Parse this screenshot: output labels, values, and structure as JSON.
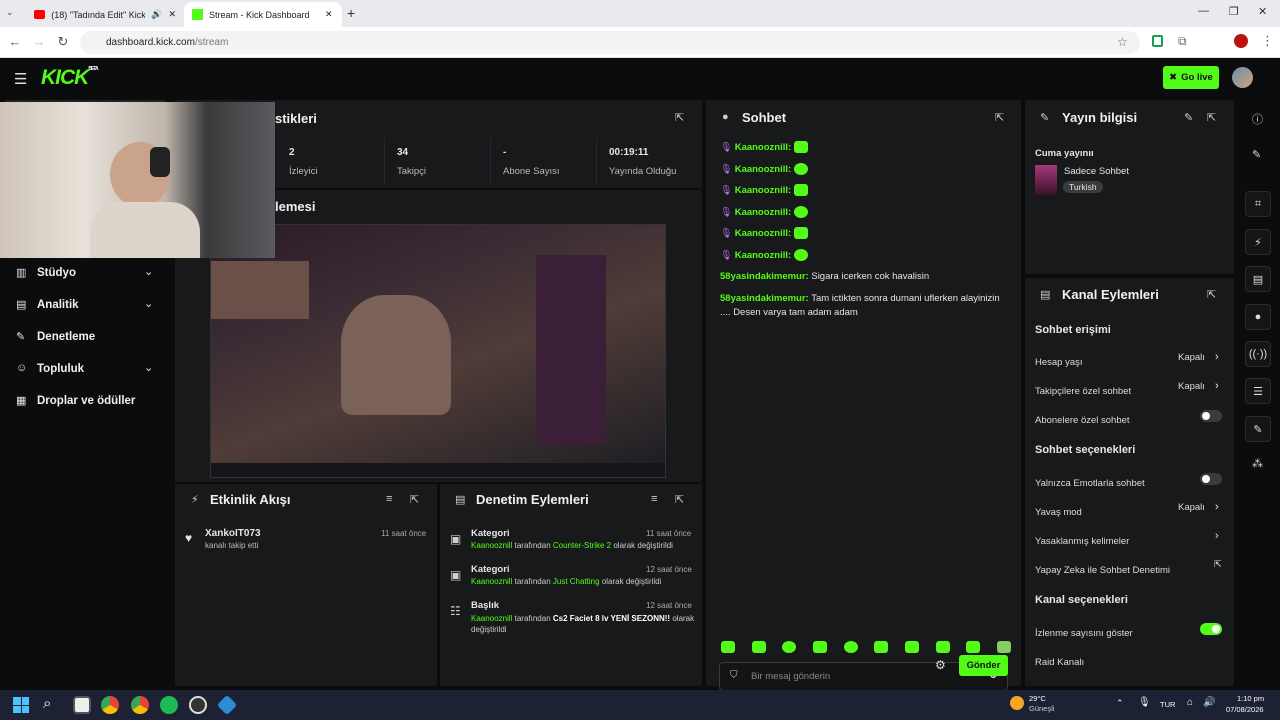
{
  "browser": {
    "tabs": [
      {
        "label": "(18) \"Tadında Edit\" Kick & T"
      },
      {
        "label": "Stream - Kick Dashboard"
      }
    ],
    "url_host": "dashboard.kick.com",
    "url_path": "/stream"
  },
  "header": {
    "logo": "KICK",
    "beta": "BETA",
    "go_live": "Go live"
  },
  "stats": {
    "title_partial": "stikleri",
    "items": [
      {
        "value": "2",
        "label": "İzleyici"
      },
      {
        "value": "34",
        "label": "Takipçi"
      },
      {
        "value": "-",
        "label": "Abone Sayısı"
      },
      {
        "value": "00:19:11",
        "label": "Yayında Olduğu"
      }
    ]
  },
  "preview": {
    "title_partial": "lemesi"
  },
  "sidebar": {
    "items": [
      {
        "label": "Stüdyo",
        "chevron": true
      },
      {
        "label": "Analitik",
        "chevron": true
      },
      {
        "label": "Denetleme",
        "chevron": false
      },
      {
        "label": "Topluluk",
        "chevron": true
      },
      {
        "label": "Droplar ve ödüller",
        "chevron": false
      }
    ]
  },
  "activity": {
    "title": "Etkinlik Akışı",
    "items": [
      {
        "user": "XankoIT073",
        "text": "kanalı takip etti",
        "time": "11 saat önce"
      }
    ]
  },
  "moderation": {
    "title": "Denetim Eylemleri",
    "items": [
      {
        "kind": "Kategori",
        "user": "Kaanooznill",
        "pre": "tarafından",
        "value": "Counter-Strike 2",
        "post": "olarak değiştirildi",
        "time": "11 saat önce"
      },
      {
        "kind": "Kategori",
        "user": "Kaanooznill",
        "pre": "tarafından",
        "value": "Just Chatting",
        "post": "olarak değiştirildi",
        "time": "12 saat önce"
      },
      {
        "kind": "Başlık",
        "user": "Kaanooznill",
        "pre": "tarafından",
        "value": "Cs2 Faciet 8 lv YENİ SEZONN!!",
        "post": "olarak değiştirildi",
        "time": "12 saat önce"
      }
    ]
  },
  "chat": {
    "title": "Sohbet",
    "emote_lines": [
      {
        "user": "Kaanooznill:"
      },
      {
        "user": "Kaanooznill:"
      },
      {
        "user": "Kaanooznill:"
      },
      {
        "user": "Kaanooznill:"
      },
      {
        "user": "Kaanooznill:"
      },
      {
        "user": "Kaanooznill:"
      }
    ],
    "messages": [
      {
        "user": "58yasindakimemur:",
        "text": "Sigara icerken cok havalisin"
      },
      {
        "user": "58yasindakimemur:",
        "text": "Tam ictikten sonra dumani uflerken alayinizin .... Desen varya tam adam adam"
      }
    ],
    "placeholder": "Bir mesaj gönderin",
    "send": "Gönder"
  },
  "stream_info": {
    "title": "Yayın bilgisi",
    "stream_title": "Cuma yayınıı",
    "category": "Sadece Sohbet",
    "tag": "Turkish"
  },
  "channel_actions": {
    "title": "Kanal Eylemleri",
    "sections": [
      {
        "heading": "Sohbet erişimi",
        "rows": [
          {
            "label": "Hesap yaşı",
            "value": "Kapalı",
            "control": "chevron"
          },
          {
            "label": "Takipçilere özel sohbet",
            "value": "Kapalı",
            "control": "chevron"
          },
          {
            "label": "Abonelere özel sohbet",
            "value": "",
            "control": "toggle-off"
          }
        ]
      },
      {
        "heading": "Sohbet seçenekleri",
        "rows": [
          {
            "label": "Yalnızca Emotlarla sohbet",
            "value": "",
            "control": "toggle-off"
          },
          {
            "label": "Yavaş mod",
            "value": "Kapalı",
            "control": "chevron"
          },
          {
            "label": "Yasaklanmış kelimeler",
            "value": "",
            "control": "chevron"
          },
          {
            "label": "Yapay Zeka ile Sohbet Denetimi",
            "value": "",
            "control": "external"
          }
        ]
      },
      {
        "heading": "Kanal seçenekleri",
        "rows": [
          {
            "label": "İzlenme sayısını göster",
            "value": "",
            "control": "toggle-on"
          },
          {
            "label": "Raid Kanalı",
            "value": "",
            "control": "none"
          }
        ]
      }
    ]
  },
  "taskbar": {
    "weather_temp": "29°C",
    "weather_text": "Güneşli",
    "lang": "TUR",
    "time": "1:10 pm",
    "date": "07/08/2026"
  },
  "colors": {
    "accent": "#53fc18",
    "bg": "#0b0c0d",
    "panel": "#18191b"
  }
}
